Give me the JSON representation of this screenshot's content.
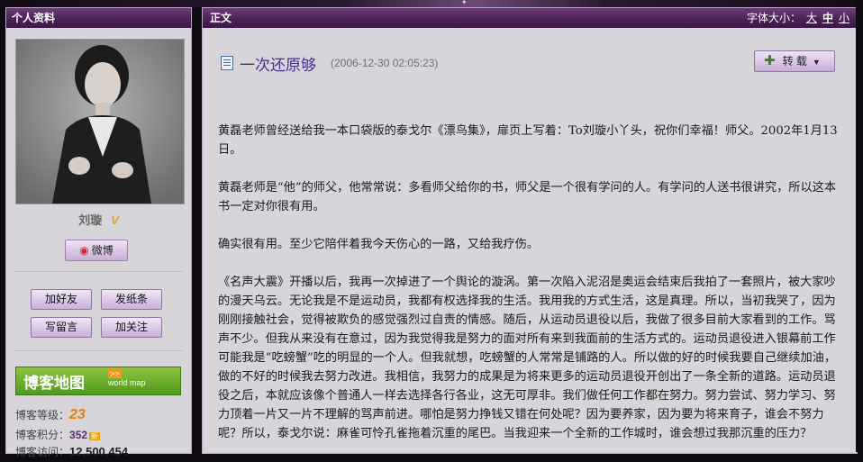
{
  "sidebar": {
    "header": "个人资料",
    "username": "刘璇",
    "verified_mark": "V",
    "weibo_button": "微博",
    "buttons": [
      "加好友",
      "发纸条",
      "写留言",
      "加关注"
    ],
    "blog_map": {
      "title": "博客地图",
      "sub": "world map"
    },
    "stats": [
      {
        "label": "博客等级：",
        "value": "23"
      },
      {
        "label": "博客积分：",
        "value": "352",
        "badge": "新"
      },
      {
        "label": "博客访问：",
        "value": "12,500,454"
      }
    ]
  },
  "main": {
    "header": "正文",
    "font_size_label": "字体大小：",
    "font_sizes": [
      "大",
      "中",
      "小"
    ],
    "post_title": "一次还原够",
    "post_time": "(2006-12-30 02:05:23)",
    "repost_button": "转 载",
    "paragraphs": [
      "黄磊老师曾经送给我一本口袋版的泰戈尔《漂鸟集》，扉页上写着：To刘璇小丫头，祝你们幸福！师父。2002年1月13日。",
      "黄磊老师是“他”的师父，他常常说：多看师父给你的书，师父是一个很有学问的人。有学问的人送书很讲究，所以这本书一定对你很有用。",
      "确实很有用。至少它陪伴着我今天伤心的一路，又给我疗伤。",
      "《名声大震》开播以后，我再一次掉进了一个舆论的漩涡。第一次陷入泥沼是奥运会结束后我拍了一套照片，被大家吵的漫天乌云。无论我是不是运动员，我都有权选择我的生活。我用我的方式生活，这是真理。所以，当初我哭了，因为刚刚接触社会，觉得被欺负的感觉强烈过自责的情感。随后，从运动员退役以后，我做了很多目前大家看到的工作。骂声不少。但我从来没有在意过，因为我觉得我是努力的面对所有来到我面前的生活方式的。运动员退役进入银幕前工作可能我是“吃螃蟹”吃的明显的一个人。但我就想，吃螃蟹的人常常是铺路的人。所以做的好的时候我要自己继续加油，做的不好的时候我去努力改进。我相信，我努力的成果是为将来更多的运动员退役开创出了一条全新的道路。运动员退役之后，本就应该像个普通人一样去选择各行各业，这无可厚非。我们做任何工作都在努力。努力尝试、努力学习、努力顶着一片又一片不理解的骂声前进。哪怕是努力挣钱又错在何处呢？因为要养家，因为要为将来育子，谁会不努力呢？所以，泰戈尔说：麻雀可怜孔雀拖着沉重的尾巴。当我迎来一个全新的工作城时，谁会想过我那沉重的压力？"
    ]
  },
  "colors": {
    "header_purple": "#4b2357",
    "title_purple": "#4a2a90",
    "panel_bg": "#d8d5da"
  }
}
